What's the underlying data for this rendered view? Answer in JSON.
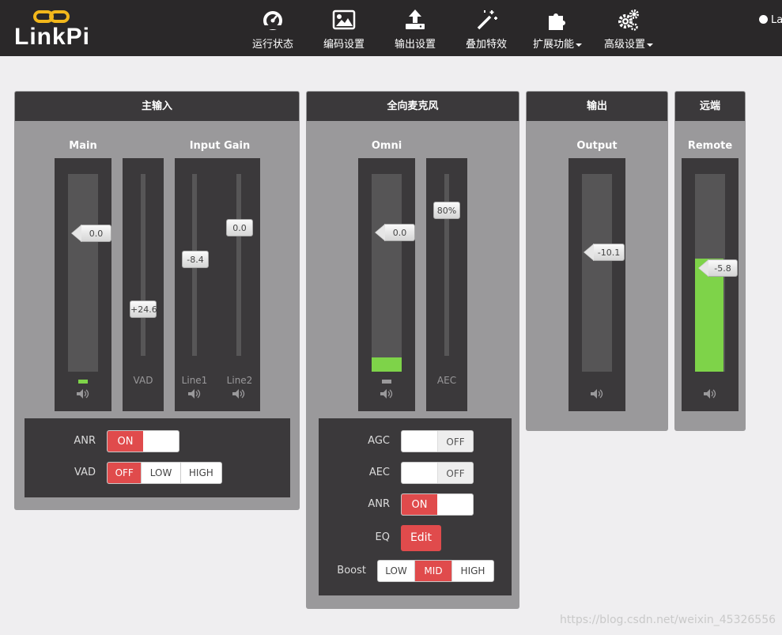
{
  "app": {
    "logo_text": "LinkPi"
  },
  "nav": [
    {
      "label": "运行状态",
      "icon": "dashboard-icon"
    },
    {
      "label": "编码设置",
      "icon": "image-icon"
    },
    {
      "label": "输出设置",
      "icon": "upload-icon"
    },
    {
      "label": "叠加特效",
      "icon": "magic-wand-icon"
    },
    {
      "label": "扩展功能",
      "icon": "puzzle-icon",
      "dropdown": true
    },
    {
      "label": "高级设置",
      "icon": "gears-icon",
      "dropdown": true
    }
  ],
  "lang": {
    "label": "La"
  },
  "panels": {
    "main_input": {
      "title": "主输入",
      "main_label": "Main",
      "gain_label": "Input Gain",
      "main_slider": {
        "value": "0.0",
        "level_fraction": 0.05
      },
      "vad_slider": {
        "value": "+24.6"
      },
      "line1_slider": {
        "value": "-8.4"
      },
      "line2_slider": {
        "value": "0.0"
      },
      "channels": {
        "vad": "VAD",
        "line1": "Line1",
        "line2": "Line2"
      },
      "anr": {
        "label": "ANR",
        "on": "ON"
      },
      "vad": {
        "label": "VAD",
        "options": [
          "OFF",
          "LOW",
          "HIGH"
        ],
        "selected": "OFF"
      }
    },
    "omni": {
      "title": "全向麦克风",
      "section_label": "Omni",
      "omni_slider": {
        "value": "0.0",
        "level_fraction": 0.07
      },
      "aec_slider": {
        "value": "80%"
      },
      "channels": {
        "aec": "AEC"
      },
      "agc": {
        "label": "AGC",
        "off": "OFF"
      },
      "aec": {
        "label": "AEC",
        "off": "OFF"
      },
      "anr": {
        "label": "ANR",
        "on": "ON"
      },
      "eq": {
        "label": "EQ",
        "button": "Edit"
      },
      "boost": {
        "label": "Boost",
        "options": [
          "LOW",
          "MID",
          "HIGH"
        ],
        "selected": "MID"
      }
    },
    "output": {
      "title": "输出",
      "section_label": "Output",
      "slider": {
        "value": "-10.1"
      }
    },
    "remote": {
      "title": "远端",
      "section_label": "Remote",
      "slider": {
        "value": "-5.8",
        "level_fraction": 0.57
      }
    }
  },
  "colors": {
    "accent": "#e04b4c",
    "level": "#7ed349",
    "header": "#2a2829"
  },
  "watermark": "https://blog.csdn.net/weixin_45326556"
}
